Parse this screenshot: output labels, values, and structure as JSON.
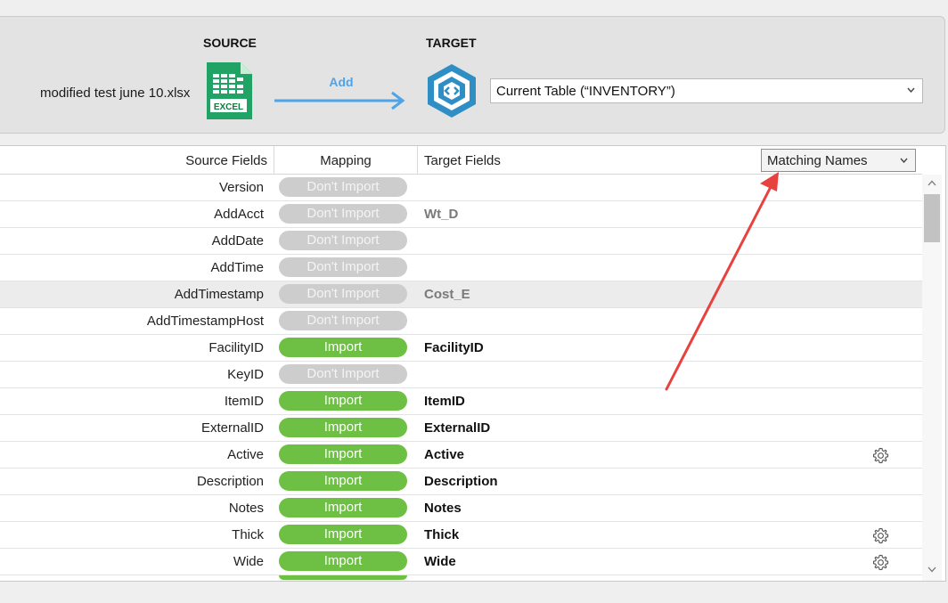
{
  "header": {
    "source_title": "SOURCE",
    "target_title": "TARGET",
    "source_filename": "modified test june 10.xlsx",
    "excel_icon_label": "EXCEL",
    "action_label": "Add",
    "target_table_value": "Current Table (“INVENTORY”)"
  },
  "table": {
    "columns": {
      "source": "Source Fields",
      "mapping": "Mapping",
      "target": "Target Fields"
    },
    "filter_value": "Matching Names",
    "rows": [
      {
        "source": "Version",
        "mapping": "Don't Import",
        "import": false,
        "target": "",
        "gear": false
      },
      {
        "source": "AddAcct",
        "mapping": "Don't Import",
        "import": false,
        "target": "Wt_D",
        "gear": false
      },
      {
        "source": "AddDate",
        "mapping": "Don't Import",
        "import": false,
        "target": "",
        "gear": false
      },
      {
        "source": "AddTime",
        "mapping": "Don't Import",
        "import": false,
        "target": "",
        "gear": false
      },
      {
        "source": "AddTimestamp",
        "mapping": "Don't Import",
        "import": false,
        "target": "Cost_E",
        "gear": false,
        "selected": true
      },
      {
        "source": "AddTimestampHost",
        "mapping": "Don't Import",
        "import": false,
        "target": "",
        "gear": false
      },
      {
        "source": "FacilityID",
        "mapping": "Import",
        "import": true,
        "target": "FacilityID",
        "gear": false
      },
      {
        "source": "KeyID",
        "mapping": "Don't Import",
        "import": false,
        "target": "",
        "gear": false
      },
      {
        "source": "ItemID",
        "mapping": "Import",
        "import": true,
        "target": "ItemID",
        "gear": false
      },
      {
        "source": "ExternalID",
        "mapping": "Import",
        "import": true,
        "target": "ExternalID",
        "gear": false
      },
      {
        "source": "Active",
        "mapping": "Import",
        "import": true,
        "target": "Active",
        "gear": true
      },
      {
        "source": "Description",
        "mapping": "Import",
        "import": true,
        "target": "Description",
        "gear": false
      },
      {
        "source": "Notes",
        "mapping": "Import",
        "import": true,
        "target": "Notes",
        "gear": false
      },
      {
        "source": "Thick",
        "mapping": "Import",
        "import": true,
        "target": "Thick",
        "gear": true
      },
      {
        "source": "Wide",
        "mapping": "Import",
        "import": true,
        "target": "Wide",
        "gear": true
      }
    ]
  },
  "colors": {
    "import_green": "#6dc043",
    "dont_import_gray": "#cdcdcd",
    "action_blue": "#4fa3e6",
    "annotation_red": "#e8423f"
  }
}
